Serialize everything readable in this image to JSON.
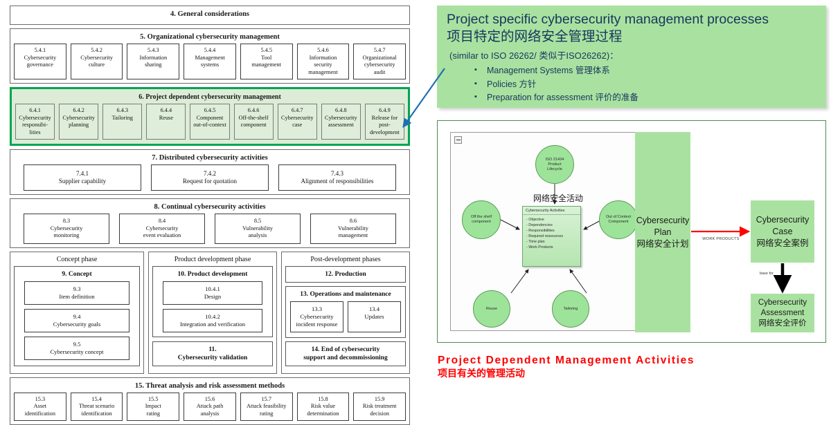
{
  "left_diagram": {
    "section4": {
      "title": "4. General considerations"
    },
    "section5": {
      "title": "5. Organizational cybersecurity management",
      "cells": [
        {
          "num": "5.4.1",
          "label": "Cybersecurity\ngovernance"
        },
        {
          "num": "5.4.2",
          "label": "Cybersecurity\nculture"
        },
        {
          "num": "5.4.3",
          "label": "Information\nsharing"
        },
        {
          "num": "5.4.4",
          "label": "Management\nsystems"
        },
        {
          "num": "5.4.5",
          "label": "Tool\nmanagement"
        },
        {
          "num": "5.4.6",
          "label": "Information\nsecurity\nmanagement"
        },
        {
          "num": "5.4.7",
          "label": "Organizational\ncybersecurity\naudit"
        }
      ]
    },
    "section6": {
      "title": "6. Project dependent cybersecurity management",
      "highlight_border_color": "#00a550",
      "highlight_fill_color": "#dcecd6",
      "cells": [
        {
          "num": "6.4.1",
          "label": "Cybersecurity\nresponsibi-\nlities"
        },
        {
          "num": "6.4.2",
          "label": "Cybersecurity\nplanning"
        },
        {
          "num": "6.4.3",
          "label": "Tailoring"
        },
        {
          "num": "6.4.4",
          "label": "Reuse"
        },
        {
          "num": "6.4.5",
          "label": "Component\nout-of-context"
        },
        {
          "num": "6.4.6",
          "label": "Off-the-shelf\ncomponent"
        },
        {
          "num": "6.4.7",
          "label": "Cybersecurity\ncase"
        },
        {
          "num": "6.4.8",
          "label": "Cybersecurity\nassessment"
        },
        {
          "num": "6.4.9",
          "label": "Release for\npost-\ndevelopment"
        }
      ]
    },
    "section7": {
      "title": "7. Distributed cybersecurity activities",
      "cells": [
        {
          "num": "7.4.1",
          "label": "Supplier capability"
        },
        {
          "num": "7.4.2",
          "label": "Request for quotation"
        },
        {
          "num": "7.4.3",
          "label": "Alignment of responsibilities"
        }
      ]
    },
    "section8": {
      "title": "8. Continual cybersecurity activities",
      "cells": [
        {
          "num": "8.3",
          "label": "Cybersecurity\nmonitoring"
        },
        {
          "num": "8.4",
          "label": "Cybersecurity\nevent evaluation"
        },
        {
          "num": "8.5",
          "label": "Vulnerability\nanalysis"
        },
        {
          "num": "8.6",
          "label": "Vulnerability\nmanagement"
        }
      ]
    },
    "phases": {
      "concept": {
        "head": "Concept phase",
        "inner_title": "9. Concept",
        "cells": [
          {
            "num": "9.3",
            "label": "Item definition"
          },
          {
            "num": "9.4",
            "label": "Cybersecurity goals"
          },
          {
            "num": "9.5",
            "label": "Cybersecurity concept"
          }
        ]
      },
      "product_development": {
        "head": "Product development phase",
        "inner_title": "10. Product development",
        "cells": [
          {
            "num": "10.4.1",
            "label": "Design"
          },
          {
            "num": "10.4.2",
            "label": "Integration and verification"
          }
        ],
        "validation_box": "11.\nCybersecurity validation"
      },
      "post_development": {
        "head": "Post-development phases",
        "production_box": "12. Production",
        "inner_title": "13. Operations and maintenance",
        "cells": [
          {
            "num": "13.3",
            "label": "Cybersecurity\nincident response"
          },
          {
            "num": "13.4",
            "label": "Updates"
          }
        ],
        "end_box": "14. End of cybersecurity\nsupport and decommissioning"
      }
    },
    "section15": {
      "title": "15. Threat analysis and risk assessment methods",
      "cells": [
        {
          "num": "15.3",
          "label": "Asset\nidentification"
        },
        {
          "num": "15.4",
          "label": "Threat scenario\nidentification"
        },
        {
          "num": "15.5",
          "label": "Impact\nrating"
        },
        {
          "num": "15.6",
          "label": "Attack path\nanalysis"
        },
        {
          "num": "15.7",
          "label": "Attack feasibility\nrating"
        },
        {
          "num": "15.8",
          "label": "Risk value\ndetermination"
        },
        {
          "num": "15.9",
          "label": "Risk treatment\ndecision"
        }
      ]
    }
  },
  "callout": {
    "background_color": "#a9e2a0",
    "text_color": "#17365d",
    "title_en": "Project specific cybersecurity management processes",
    "title_cn": "项目特定的网络安全管理过程",
    "subtitle": "(similar to ISO 26262/ 类似于ISO26262)：",
    "bullets": [
      "Management Systems 管理体系",
      "Policies 方针",
      "Preparation for assessment 评价的准备"
    ],
    "arrow_color": "#1f6fb5"
  },
  "diagram": {
    "border_color": "#4d8a4d",
    "collapse_icon": "minus-icon",
    "circles": [
      {
        "name": "iso-lifecycle",
        "label": "ISO 21434\nProduct\nLifecycle"
      },
      {
        "name": "off-the-shelf",
        "label": "Off the shelf\ncomponent"
      },
      {
        "name": "out-of-context",
        "label": "Out of Context\nComponent"
      },
      {
        "name": "reuse",
        "label": "Reuse"
      },
      {
        "name": "tailoring",
        "label": "Tailoring"
      }
    ],
    "activities_box": {
      "header": "Cybersecurity Activities",
      "cn_label": "网络安全活动",
      "items": [
        "Objective",
        "Dependencies",
        "Responsibilities",
        "Required ressources",
        "Time plan",
        "Work Products"
      ]
    },
    "plan_block": {
      "en": "Cybersecurity\nPlan",
      "cn": "网络安全计划"
    },
    "case_block": {
      "en": "Cybersecurity\nCase",
      "cn": "网络安全案例"
    },
    "assessment_block": {
      "en": "Cybersecurity\nAssessment",
      "cn": "网络安全评价"
    },
    "work_products_label": "WORK PRODUCTS",
    "base_for_label": "base for",
    "arrow_plan_to_case_color": "#ff0000",
    "arrow_case_to_assessment_color": "#000000"
  },
  "caption": {
    "color": "#ff0000",
    "english": "Project Dependent Management Activities",
    "chinese": "项目有关的管理活动"
  }
}
